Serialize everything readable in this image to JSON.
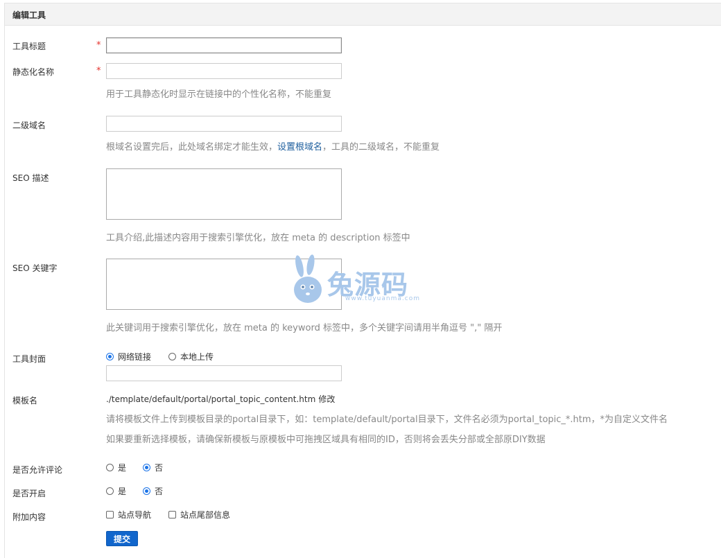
{
  "panel": {
    "title": "编辑工具"
  },
  "form": {
    "title": {
      "label": "工具标题",
      "required_mark": "*",
      "value": ""
    },
    "static_name": {
      "label": "静态化名称",
      "required_mark": "*",
      "value": "",
      "hint": "用于工具静态化时显示在链接中的个性化名称，不能重复"
    },
    "subdomain": {
      "label": "二级域名",
      "value": "",
      "hint_before": "根域名设置完后，此处域名绑定才能生效，",
      "hint_link": "设置根域名",
      "hint_after": "，工具的二级域名，不能重复"
    },
    "seo_desc": {
      "label": "SEO 描述",
      "value": "",
      "hint": "工具介绍,此描述内容用于搜索引擎优化，放在 meta 的 description 标签中"
    },
    "seo_keywords": {
      "label": "SEO 关键字",
      "value": "",
      "hint": "此关键词用于搜索引擎优化，放在 meta 的 keyword 标签中，多个关键字间请用半角逗号 \",\" 隔开"
    },
    "cover": {
      "label": "工具封面",
      "option_network": "网络链接",
      "option_local": "本地上传",
      "selected": "network",
      "value": ""
    },
    "template": {
      "label": "模板名",
      "path": "./template/default/portal/portal_topic_content.htm",
      "modify_link": "修改",
      "hint1": "请将模板文件上传到模板目录的portal目录下，如：template/default/portal目录下，文件名必须为portal_topic_*.htm，*为自定义文件名",
      "hint2": "如果要重新选择模板，请确保新模板与原模板中可拖拽区域具有相同的ID，否则将会丢失分部或全部原DIY数据"
    },
    "allow_comment": {
      "label": "是否允许评论",
      "option_yes": "是",
      "option_no": "否",
      "selected": "no"
    },
    "enabled": {
      "label": "是否开启",
      "option_yes": "是",
      "option_no": "否",
      "selected": "no"
    },
    "extra": {
      "label": "附加内容",
      "option_nav": "站点导航",
      "option_footer": "站点尾部信息",
      "nav_checked": false,
      "footer_checked": false
    },
    "submit_label": "提交"
  },
  "watermark": {
    "brand": "兔源码",
    "url": "www.tuyuanma.com",
    "icon": "bunny-logo-icon"
  },
  "colors": {
    "accent": "#1a73e8",
    "button": "#1166cc",
    "required": "#e5322d",
    "hint": "#888888",
    "link": "#1e5f9e",
    "watermark": "#a8c7ea"
  }
}
